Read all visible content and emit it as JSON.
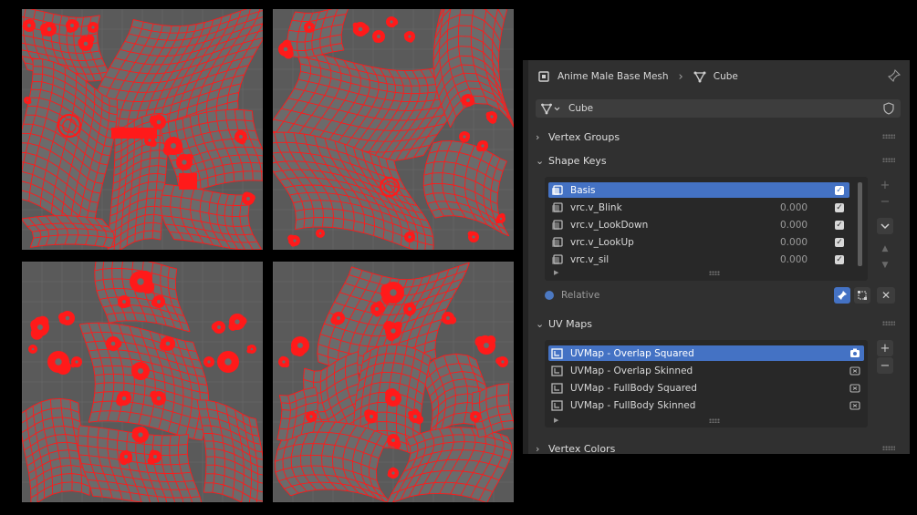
{
  "uv_editor": {
    "panels": [
      "uv-top-left",
      "uv-top-right",
      "uv-bottom-left",
      "uv-bottom-right"
    ],
    "colors": {
      "background": "#5a5a5a",
      "grid": "#6a6a6a",
      "mesh_wire": "#ff1a1a",
      "mesh_face": "#6b6b6b"
    }
  },
  "properties": {
    "breadcrumb": {
      "object": "Anime Male Base Mesh",
      "mesh": "Cube"
    },
    "mesh_datablock": "Cube",
    "sections": {
      "vertex_groups": "Vertex Groups",
      "shape_keys": "Shape Keys",
      "uv_maps": "UV Maps",
      "vertex_colors": "Vertex Colors"
    },
    "shape_keys": [
      {
        "name": "Basis",
        "value": "",
        "enabled": true,
        "selected": true
      },
      {
        "name": "vrc.v_Blink",
        "value": "0.000",
        "enabled": true,
        "selected": false
      },
      {
        "name": "vrc.v_LookDown",
        "value": "0.000",
        "enabled": true,
        "selected": false
      },
      {
        "name": "vrc.v_LookUp",
        "value": "0.000",
        "enabled": true,
        "selected": false
      },
      {
        "name": "vrc.v_sil",
        "value": "0.000",
        "enabled": true,
        "selected": false
      }
    ],
    "relative_label": "Relative",
    "uv_maps": [
      {
        "name": "UVMap - Overlap Squared",
        "active_render": true,
        "selected": true
      },
      {
        "name": "UVMap - Overlap Skinned",
        "active_render": false,
        "selected": false
      },
      {
        "name": "UVMap - FullBody Squared",
        "active_render": false,
        "selected": false
      },
      {
        "name": "UVMap - FullBody Skinned",
        "active_render": false,
        "selected": false
      }
    ],
    "colors": {
      "panel": "#303030",
      "list": "#282828",
      "accent": "#4472c4"
    }
  }
}
